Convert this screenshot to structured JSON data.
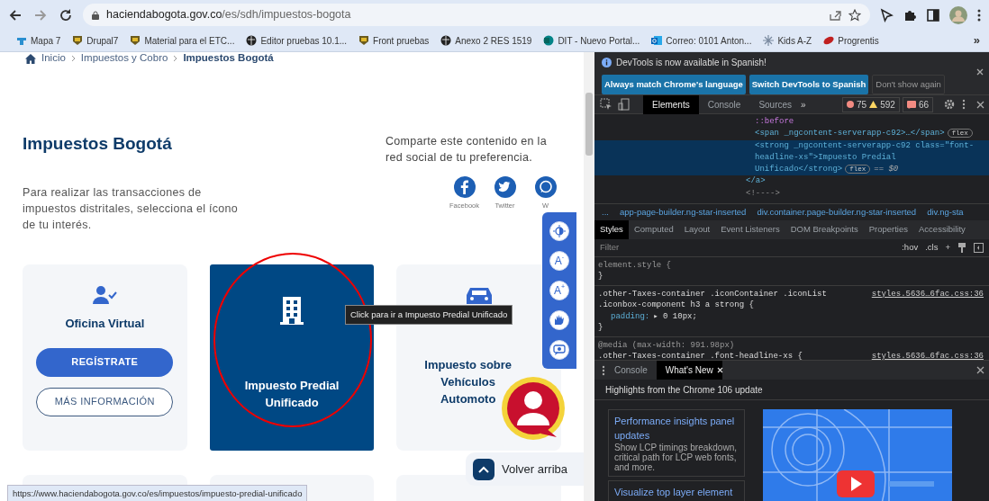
{
  "browser": {
    "url_host": "haciendabogota.gov.co",
    "url_path": "/es/sdh/impuestos-bogota",
    "more": "»",
    "bookmarks": [
      {
        "kind": "map",
        "label": "Mapa 7"
      },
      {
        "kind": "shield",
        "label": "Drupal7"
      },
      {
        "kind": "shield",
        "label": "Material para el ETC..."
      },
      {
        "kind": "globe",
        "label": "Editor pruebas 10.1..."
      },
      {
        "kind": "shield",
        "label": "Front pruebas"
      },
      {
        "kind": "globe",
        "label": "Anexo 2 RES 1519"
      },
      {
        "kind": "sharepoint",
        "label": "DIT - Nuevo Portal..."
      },
      {
        "kind": "outlook",
        "label": "Correo: 0101 Anton..."
      },
      {
        "kind": "sparkle",
        "label": "Kids A-Z"
      },
      {
        "kind": "leaf",
        "label": "Progrentis"
      }
    ]
  },
  "page": {
    "breadcrumb": [
      {
        "label": "Inicio",
        "current": false
      },
      {
        "label": "Impuestos y Cobro",
        "current": false
      },
      {
        "label": "Impuestos Bogotá",
        "current": true
      }
    ],
    "title": "Impuestos Bogotá",
    "intro": "Para realizar las transacciones de impuestos distritales, selecciona el ícono de tu interés.",
    "share_text": "Comparte este contenido en la red social de tu preferencia.",
    "social": [
      {
        "kind": "facebook",
        "label": "Facebook"
      },
      {
        "kind": "twitter",
        "label": "Twitter"
      },
      {
        "kind": "whatsapp",
        "label": "W"
      }
    ],
    "cards": [
      {
        "kind": "user",
        "title": "Oficina Virtual",
        "selected": false,
        "buttons": [
          {
            "label": "REGÍSTRATE",
            "primary": true
          },
          {
            "label": "MÁS INFORMACIÓN",
            "primary": false
          }
        ]
      },
      {
        "kind": "building",
        "title": "Impuesto Predial Unificado",
        "selected": true
      },
      {
        "kind": "car",
        "title": "Impuesto sobre Vehículos Automoto",
        "selected": false
      }
    ],
    "tools": [
      {
        "kind": "contrast"
      },
      {
        "kind": "font",
        "label": "A$^{-}$"
      },
      {
        "kind": "font",
        "label": "A$^{+}$"
      },
      {
        "kind": "hands"
      },
      {
        "kind": "chat"
      }
    ],
    "tooltip": "Click para ir a Impuesto Predial Unificado",
    "back_to_top": "Volver arriba",
    "status_url": "https://www.haciendabogota.gov.co/es/impuestos/impuesto-predial-unificado"
  },
  "devtools": {
    "notice": "DevTools is now available in Spanish!",
    "notice_buttons": [
      {
        "label": "Always match Chrome's language",
        "primary": true
      },
      {
        "label": "Switch DevTools to Spanish",
        "primary": true
      },
      {
        "label": "Don't show again",
        "primary": false
      }
    ],
    "tabs": [
      {
        "label": "Elements",
        "selected": true
      },
      {
        "label": "Console",
        "selected": false
      },
      {
        "label": "Sources",
        "selected": false
      }
    ],
    "more_tabs": "»",
    "errors": "75",
    "warnings": "592",
    "issues": "66",
    "dom_lines": [
      {
        "children": [
          {
            "text": "::before",
            "kind": "pseudo",
            "selected": false
          },
          {
            "text": "<span _ngcontent-serverapp-c92>…</span>",
            "kind": "tag",
            "selected": false,
            "badge": "flex"
          },
          {
            "text": "<strong _ngcontent-serverapp-c92 class=\"font-headline-xs\">Impuesto Predial Unificado</strong>",
            "kind": "tag",
            "selected": true,
            "badge": "flex",
            "suffix": "== $0"
          }
        ]
      },
      {
        "text": "</a>",
        "kind": "tag",
        "selected": false
      },
      {
        "text": "<!---->",
        "kind": "comment",
        "selected": false
      }
    ],
    "path": [
      "...",
      "app-page-builder.ng-star-inserted",
      "div.container.page-builder.ng-star-inserted",
      "div.ng-sta"
    ],
    "style_tabs": [
      {
        "label": "Styles",
        "selected": true
      },
      {
        "label": "Computed",
        "selected": false
      },
      {
        "label": "Layout",
        "selected": false
      },
      {
        "label": "Event Listeners",
        "selected": false
      },
      {
        "label": "DOM Breakpoints",
        "selected": false
      },
      {
        "label": "Properties",
        "selected": false
      },
      {
        "label": "Accessibility",
        "selected": false
      }
    ],
    "filter_placeholder": "Filter",
    "hov": ":hov",
    "cls": ".cls",
    "plus": "+",
    "rules": [
      {
        "selector": "element.style {",
        "close": "}"
      },
      {
        "selector": ".other-Taxes-container .iconContainer .iconList .iconbox-component h3 a strong {",
        "source": "styles.5636…6fac.css:36",
        "declarations": [
          {
            "property": "padding:",
            "value": "▸ 0 10px;"
          }
        ],
        "close": "}"
      },
      {
        "media": "@media (max-width: 991.98px)",
        "selector": ".other-Taxes-container .font-headline-xs {",
        "source": "styles.5636…6fac.css:36"
      }
    ],
    "drawer_tabs": [
      {
        "label": "Console",
        "selected": false
      },
      {
        "label": "What's New",
        "selected": true
      }
    ],
    "highlights": "Highlights from the Chrome 106 update",
    "features": [
      {
        "title": "Performance insights panel updates",
        "description": "Show LCP timings breakdown, critical path for LCP web fonts, and more."
      },
      {
        "title": "Visualize top layer element"
      }
    ]
  }
}
